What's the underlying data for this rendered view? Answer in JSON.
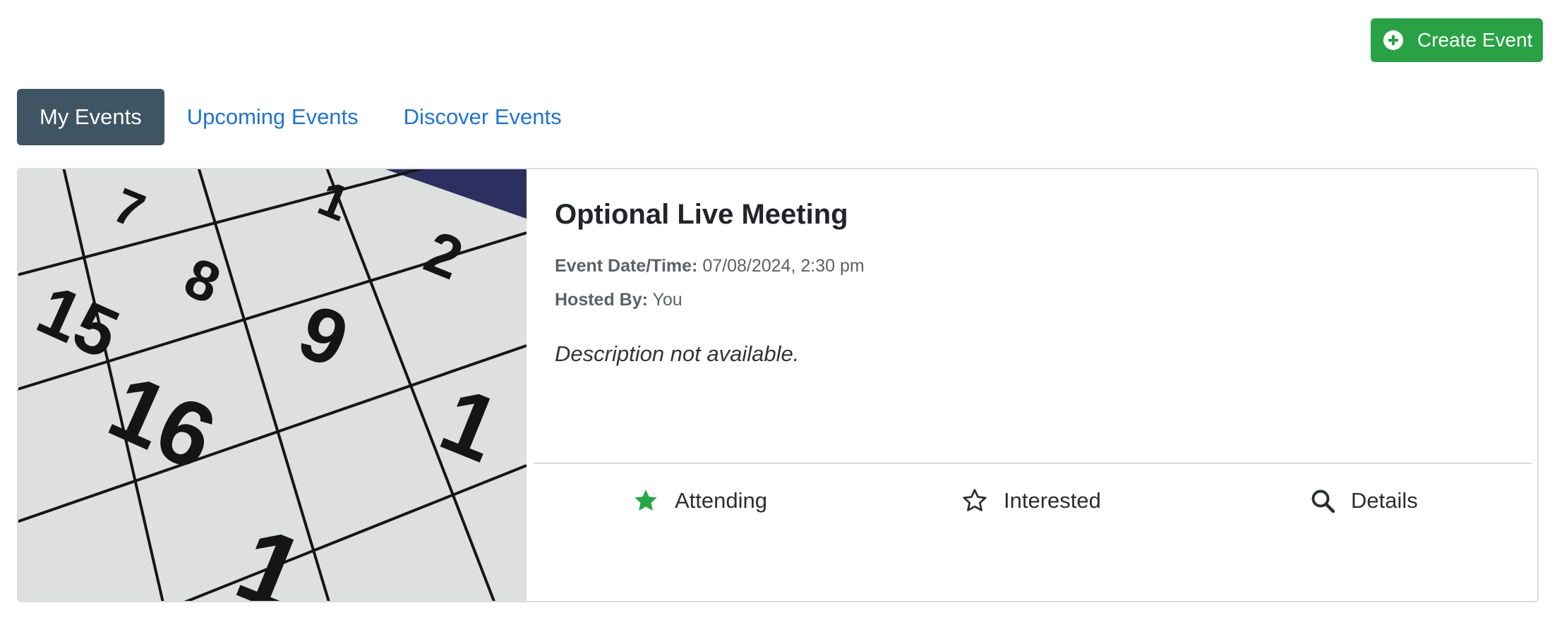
{
  "header": {
    "create_event_label": "Create Event"
  },
  "tabs": [
    {
      "label": "My Events",
      "active": true
    },
    {
      "label": "Upcoming Events",
      "active": false
    },
    {
      "label": "Discover Events",
      "active": false
    }
  ],
  "event": {
    "title": "Optional Live Meeting",
    "date_label": "Event Date/Time:",
    "date_value": "07/08/2024, 2:30 pm",
    "host_label": "Hosted By:",
    "host_value": "You",
    "description": "Description not available.",
    "image_icon": "calendar-photo",
    "actions": {
      "attending": {
        "label": "Attending",
        "icon": "star-filled-icon",
        "color": "#28a745"
      },
      "interested": {
        "label": "Interested",
        "icon": "star-outline-icon"
      },
      "details": {
        "label": "Details",
        "icon": "search-icon"
      }
    }
  },
  "colors": {
    "primary_green": "#28a245",
    "tab_active_bg": "#3f5563",
    "link_blue": "#1e74d6"
  }
}
